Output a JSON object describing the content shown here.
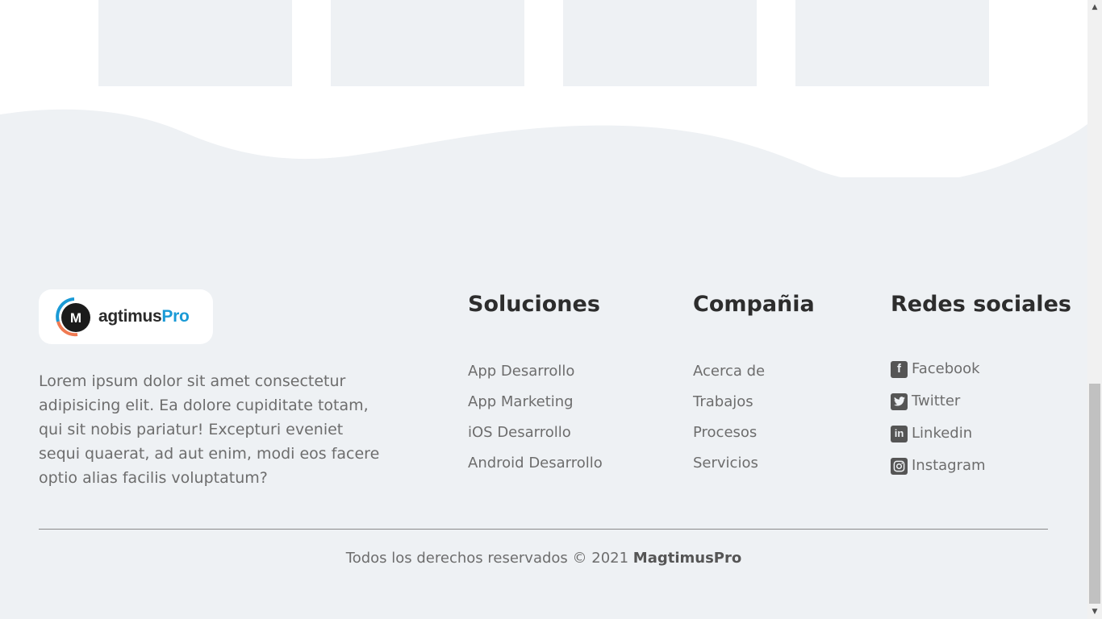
{
  "brand": {
    "logo_text_dark": "agtimus",
    "logo_text_accent": "Pro",
    "accent_color": "#1a9ad6"
  },
  "footer": {
    "description": "Lorem ipsum dolor sit amet consectetur adipisicing elit. Ea dolore cupiditate totam, qui sit nobis pariatur! Excepturi eveniet sequi quaerat, ad aut enim, modi eos facere optio alias facilis voluptatum?",
    "solutions": {
      "title": "Soluciones",
      "items": [
        "App Desarrollo",
        "App Marketing",
        "iOS Desarrollo",
        "Android Desarrollo"
      ]
    },
    "company": {
      "title": "Compañia",
      "items": [
        "Acerca de",
        "Trabajos",
        "Procesos",
        "Servicios"
      ]
    },
    "social": {
      "title": "Redes sociales",
      "items": [
        {
          "label": "Facebook",
          "icon": "facebook-icon"
        },
        {
          "label": "Twitter",
          "icon": "twitter-icon"
        },
        {
          "label": "Linkedin",
          "icon": "linkedin-icon"
        },
        {
          "label": "Instagram",
          "icon": "instagram-icon"
        }
      ]
    },
    "copyright_text": "Todos los derechos reservados © 2021",
    "copyright_brand": "MagtimusPro"
  }
}
